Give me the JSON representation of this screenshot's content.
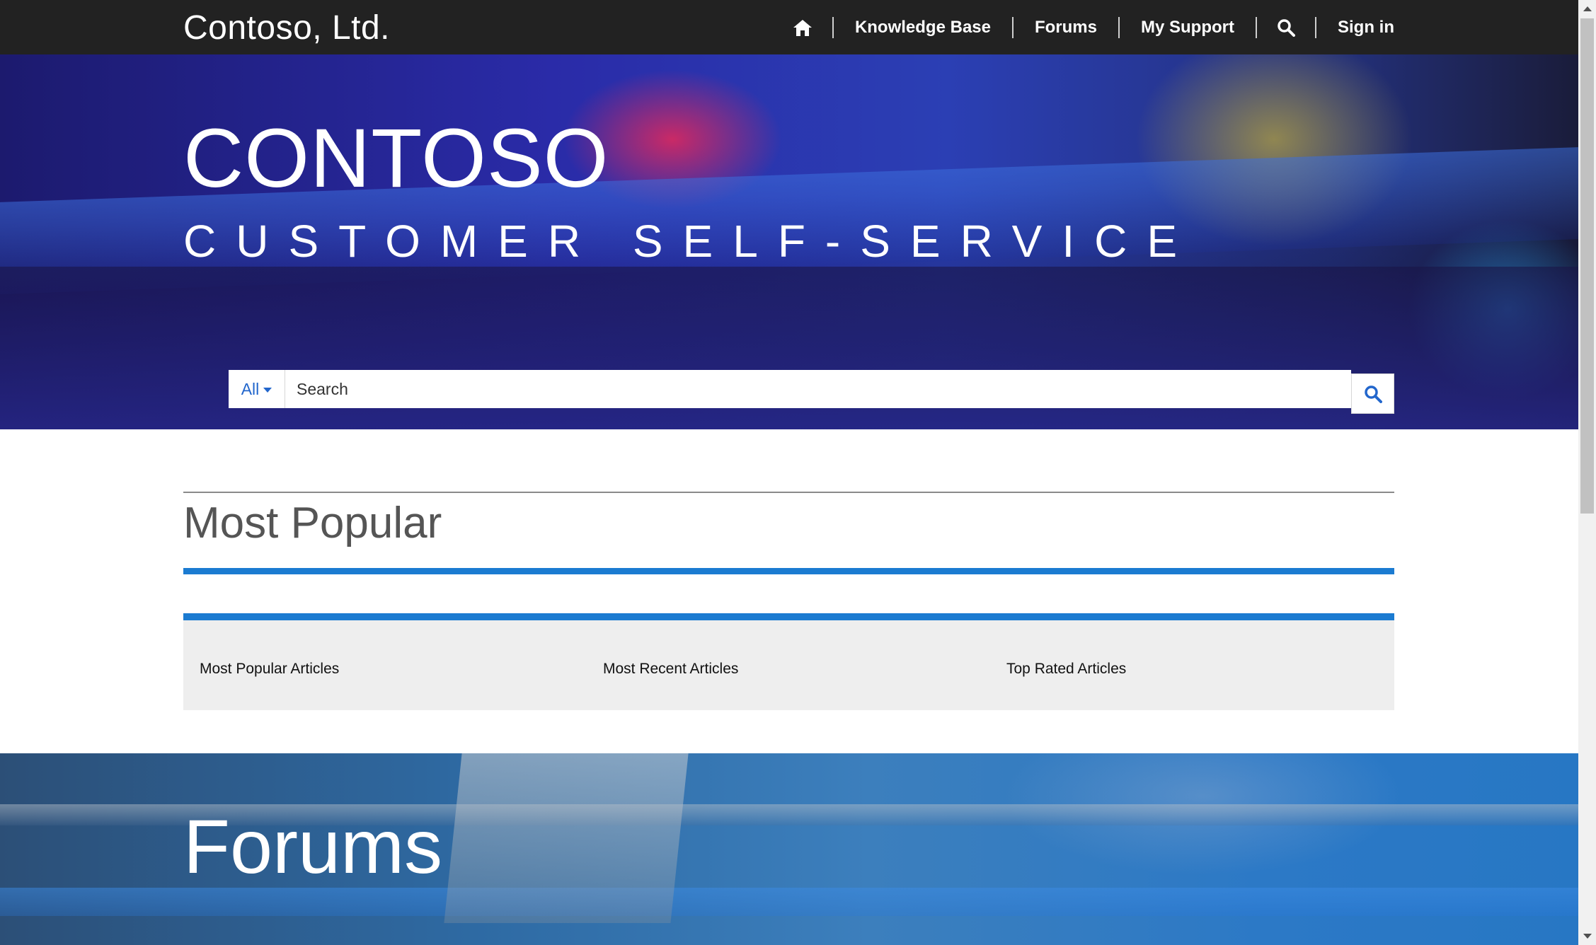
{
  "brand": "Contoso, Ltd.",
  "nav": {
    "home_icon": "home-icon",
    "knowledge_base": "Knowledge Base",
    "forums": "Forums",
    "my_support": "My Support",
    "search_icon": "search-icon",
    "sign_in": "Sign in"
  },
  "hero": {
    "title": "CONTOSO",
    "subtitle": "CUSTOMER SELF-SERVICE"
  },
  "search": {
    "filter_label": "All",
    "placeholder": "Search",
    "button_icon": "search-icon"
  },
  "most_popular": {
    "title": "Most Popular",
    "tabs": [
      {
        "label": "Most Popular Articles"
      },
      {
        "label": "Most Recent Articles"
      },
      {
        "label": "Top Rated Articles"
      }
    ]
  },
  "forums": {
    "title": "Forums"
  },
  "colors": {
    "nav_bg": "#222222",
    "accent_blue": "#1b7bd1",
    "link_blue": "#2266cc",
    "tab_bg": "#eeeeee"
  }
}
